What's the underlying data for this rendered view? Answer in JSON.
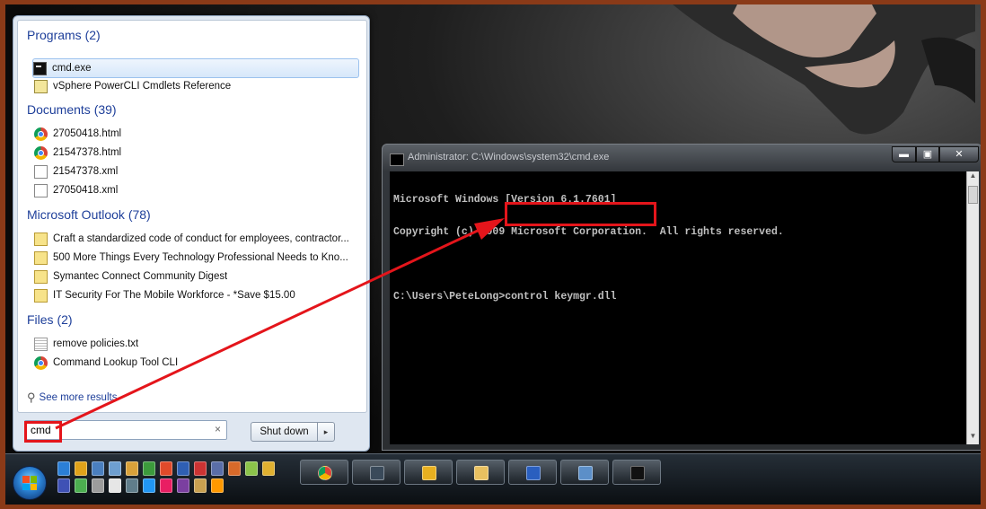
{
  "start_menu": {
    "groups": [
      {
        "title": "Programs (2)",
        "items": [
          {
            "label": "cmd.exe",
            "icon": "cmd-icon"
          },
          {
            "label": "vSphere PowerCLI Cmdlets Reference",
            "icon": "help-file-icon"
          }
        ]
      },
      {
        "title": "Documents (39)",
        "items": [
          {
            "label": "27050418.html",
            "icon": "chrome-icon"
          },
          {
            "label": "21547378.html",
            "icon": "chrome-icon"
          },
          {
            "label": "21547378.xml",
            "icon": "xml-file-icon"
          },
          {
            "label": "27050418.xml",
            "icon": "xml-file-icon"
          }
        ]
      },
      {
        "title": "Microsoft Outlook (78)",
        "items": [
          {
            "label": "Craft a standardized code of conduct for employees, contractor...",
            "icon": "mail-icon"
          },
          {
            "label": "500 More Things Every Technology Professional Needs to Kno...",
            "icon": "mail-icon"
          },
          {
            "label": "Symantec Connect Community Digest",
            "icon": "mail-icon"
          },
          {
            "label": "IT Security For The Mobile Workforce - *Save $15.00",
            "icon": "mail-icon"
          }
        ]
      },
      {
        "title": "Files (2)",
        "items": [
          {
            "label": "remove policies.txt",
            "icon": "text-file-icon"
          },
          {
            "label": "Command Lookup Tool CLI",
            "icon": "chrome-icon"
          }
        ]
      }
    ],
    "see_more": "See more results",
    "search_value": "cmd",
    "clear_glyph": "×",
    "shutdown_label": "Shut down",
    "shutdown_arrow": "▸"
  },
  "cmd": {
    "title": "Administrator: C:\\Windows\\system32\\cmd.exe",
    "controls": {
      "minimize": "▬",
      "maximize": "▣",
      "close": "✕"
    },
    "lines": [
      "Microsoft Windows [Version 6.1.7601]",
      "Copyright (c) 2009 Microsoft Corporation.  All rights reserved.",
      "",
      "C:\\Users\\PeteLong>control keymgr.dll"
    ]
  },
  "colors": {
    "highlight": "#e4151b",
    "console_bg": "#000000",
    "console_text": "#c0c0c0",
    "group_title": "#1e3f9a"
  }
}
